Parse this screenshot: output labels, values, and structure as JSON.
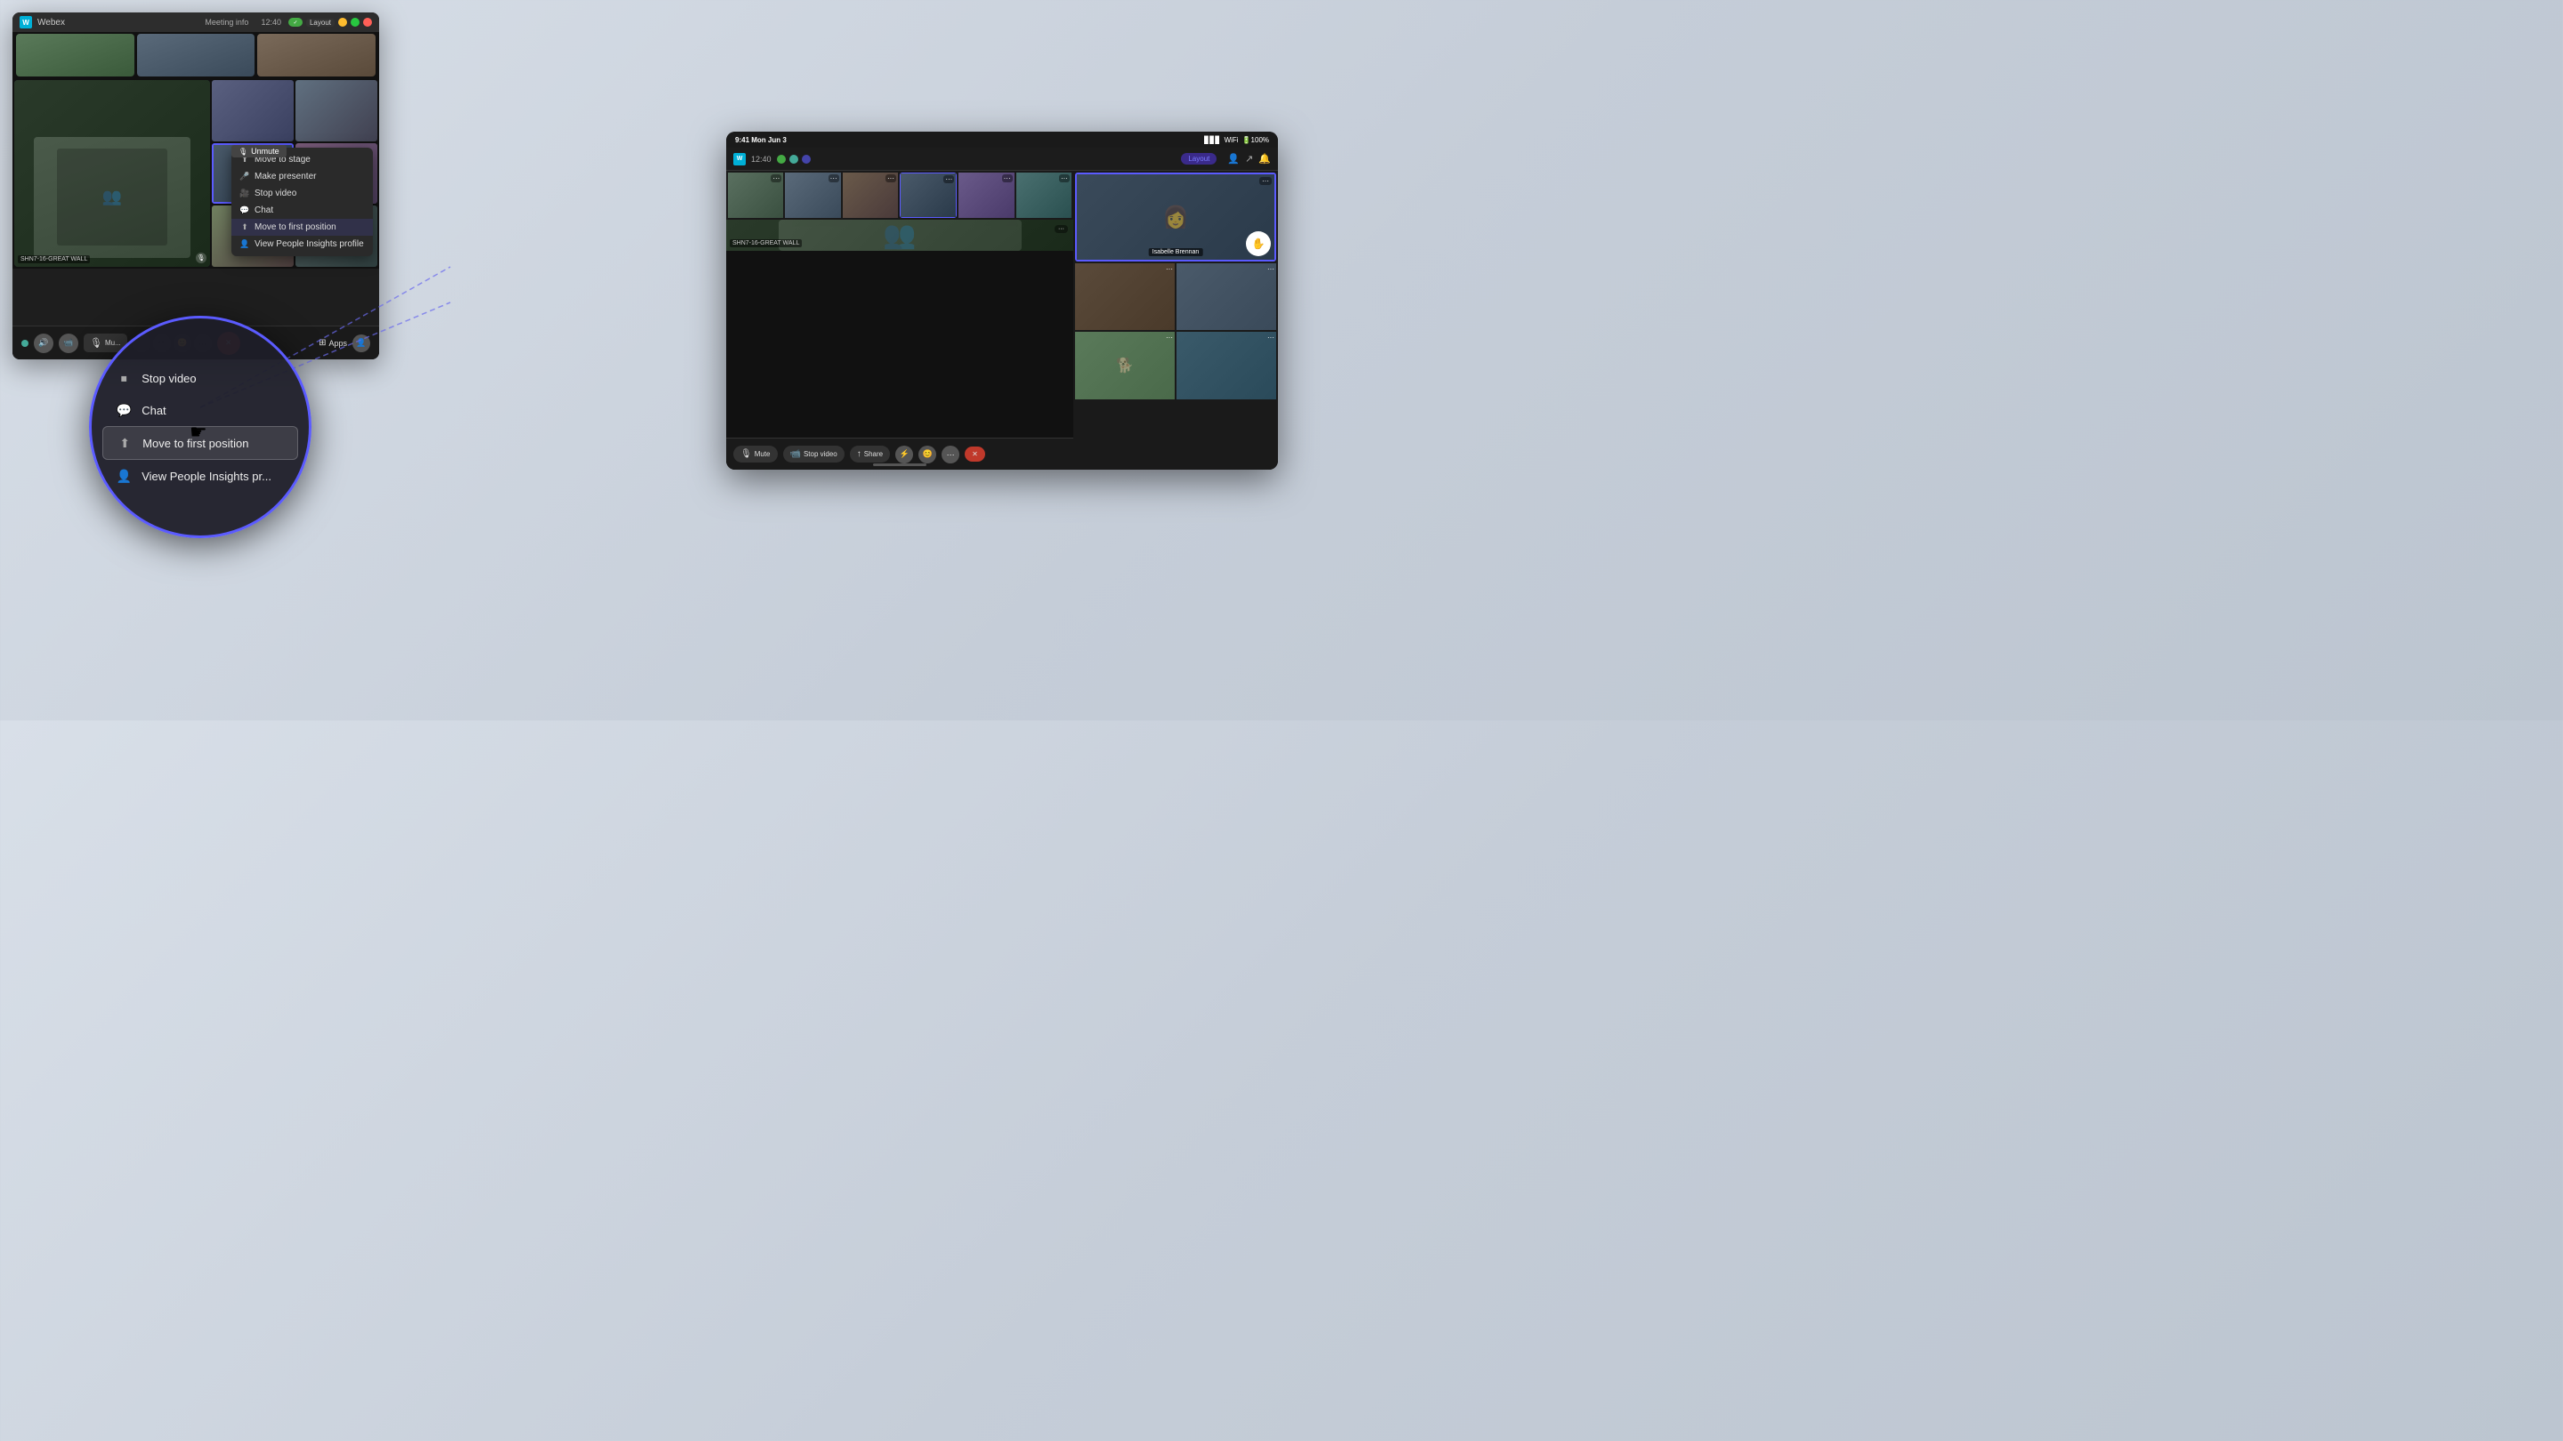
{
  "app": {
    "name": "Webex",
    "meeting_info": "Meeting info",
    "time": "12:40",
    "layout_btn": "Layout"
  },
  "titlebar": {
    "close": "✕",
    "minimize": "–",
    "maximize": "□"
  },
  "context_menu": {
    "unmute": "Unmute",
    "items": [
      {
        "label": "Move to stage",
        "icon": "⬆"
      },
      {
        "label": "Make presenter",
        "icon": "🎤"
      },
      {
        "label": "Stop video",
        "icon": "🎥"
      },
      {
        "label": "Chat",
        "icon": "💬"
      },
      {
        "label": "Move to first position",
        "icon": "⬆"
      },
      {
        "label": "View People Insights profile",
        "icon": "👤"
      }
    ]
  },
  "circle_menu": {
    "items": [
      {
        "label": "Stop video",
        "icon": "⏹"
      },
      {
        "label": "Chat",
        "icon": "💬"
      },
      {
        "label": "Move to first position",
        "icon": "⬆"
      },
      {
        "label": "View People Insights pr...",
        "icon": "👤"
      }
    ]
  },
  "toolbar": {
    "mute": "Mu...",
    "apps": "Apps",
    "end_call": "✕",
    "stop_video": "Stop video",
    "share": "Share"
  },
  "room_label": "SHN7-16-GREAT WALL",
  "tablet": {
    "time": "9:41 Mon Jun 3",
    "meeting_time": "12:40",
    "layout": "Layout",
    "person_name": "Isabelle Brennan",
    "room_label": "SHN7-16-GREAT WALL",
    "mute": "Mute",
    "stop_video": "Stop video",
    "share": "Share"
  }
}
